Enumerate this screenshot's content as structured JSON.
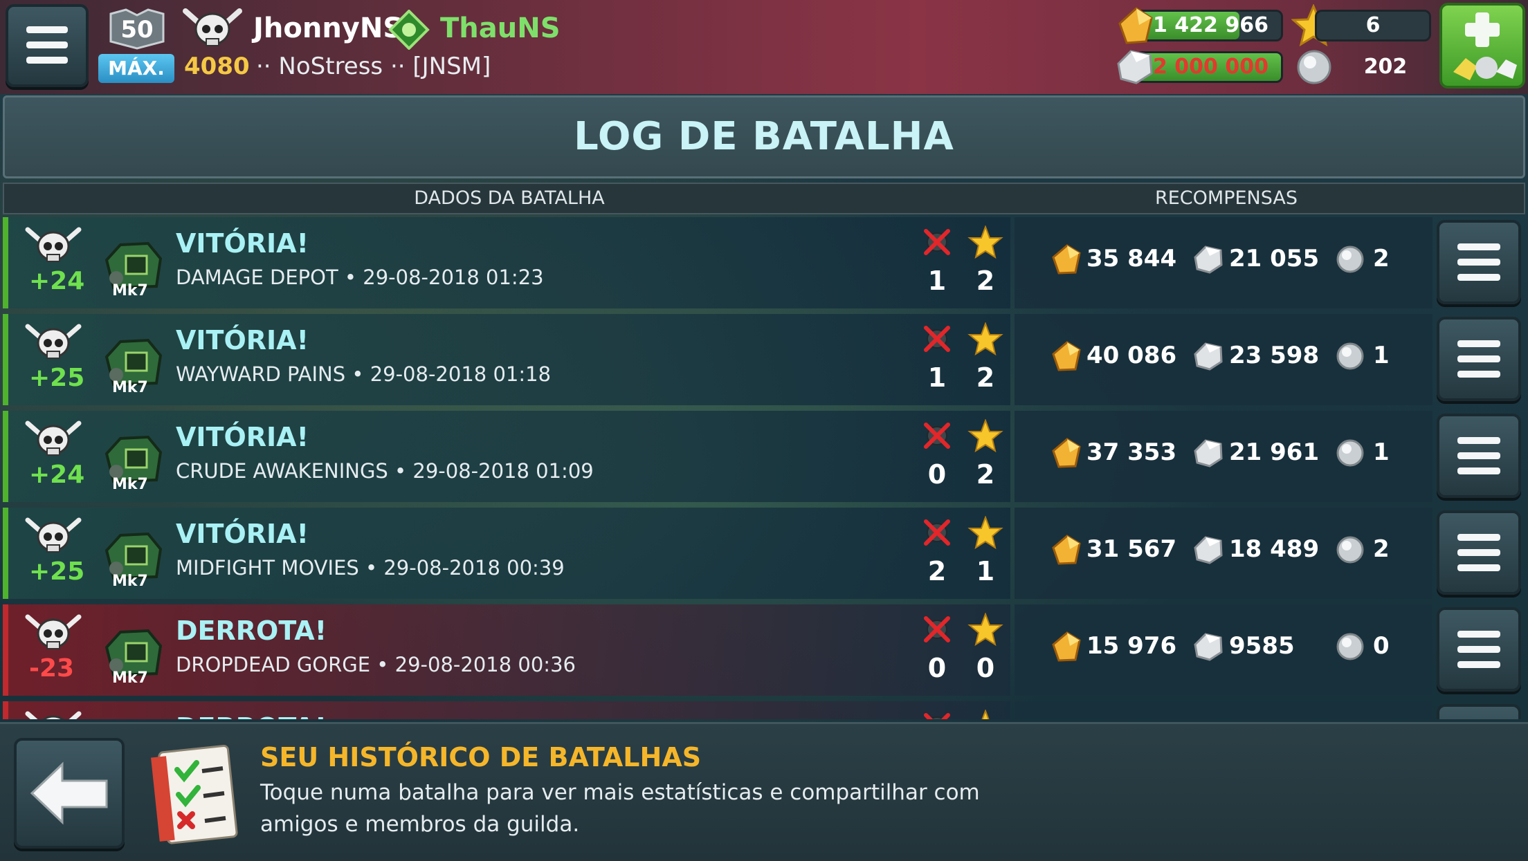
{
  "header": {
    "level": "50",
    "level_label": "MÁX.",
    "trophies": "4080",
    "player_name": "JhonnyNS",
    "guild_name": "ThauNS",
    "guild_tag": "·· NoStress ·· [JNSM]",
    "gold": "1 422 966",
    "silver": "2 000 000",
    "gold_fill_fraction": 0.71,
    "silver_fill_fraction": 1.0,
    "stars": "6",
    "tokens": "202"
  },
  "page": {
    "title": "LOG DE BATALHA",
    "col_battle": "DADOS DA BATALHA",
    "col_rewards": "RECOMPENSAS"
  },
  "battles": [
    {
      "result": "VITÓRIA!",
      "outcome": "win",
      "delta": "+24",
      "robot_mark": "Mk7",
      "map": "DAMAGE DEPOT",
      "datetime": "29-08-2018 01:23",
      "kills": "1",
      "stars": "2",
      "gold": "35 844",
      "silver": "21 055",
      "tokens": "2"
    },
    {
      "result": "VITÓRIA!",
      "outcome": "win",
      "delta": "+25",
      "robot_mark": "Mk7",
      "map": "WAYWARD PAINS",
      "datetime": "29-08-2018 01:18",
      "kills": "1",
      "stars": "2",
      "gold": "40 086",
      "silver": "23 598",
      "tokens": "1"
    },
    {
      "result": "VITÓRIA!",
      "outcome": "win",
      "delta": "+24",
      "robot_mark": "Mk7",
      "map": "CRUDE AWAKENINGS",
      "datetime": "29-08-2018 01:09",
      "kills": "0",
      "stars": "2",
      "gold": "37 353",
      "silver": "21 961",
      "tokens": "1"
    },
    {
      "result": "VITÓRIA!",
      "outcome": "win",
      "delta": "+25",
      "robot_mark": "Mk7",
      "map": "MIDFIGHT MOVIES",
      "datetime": "29-08-2018 00:39",
      "kills": "2",
      "stars": "1",
      "gold": "31 567",
      "silver": "18 489",
      "tokens": "2"
    },
    {
      "result": "DERROTA!",
      "outcome": "loss",
      "delta": "-23",
      "robot_mark": "Mk7",
      "map": "DROPDEAD GORGE",
      "datetime": "29-08-2018 00:36",
      "kills": "0",
      "stars": "0",
      "gold": "15 976",
      "silver": "9585",
      "tokens": "0"
    },
    {
      "result": "DERROTA!",
      "outcome": "loss",
      "delta": "",
      "robot_mark": "",
      "map": "",
      "datetime": "",
      "kills": "",
      "stars": "",
      "gold": "",
      "silver": "",
      "tokens": ""
    }
  ],
  "footer": {
    "title": "SEU HISTÓRICO DE BATALHAS",
    "text": "Toque numa batalha para ver mais estatísticas e compartilhar com amigos e membros da guilda."
  },
  "icons": {
    "menu": "hamburger-menu-icon",
    "back": "back-arrow-icon",
    "shop": "plus-shop-icon",
    "gold": "gold-icon",
    "silver": "silver-icon",
    "star": "star-icon",
    "token": "token-icon",
    "kill": "kill-icon",
    "log": "battle-log-icon"
  },
  "colors": {
    "win": "#4fb32e",
    "loss": "#c0292e",
    "title": "#c9f3f6",
    "gold_text": "#f5c845",
    "footer_title": "#f5b62a"
  }
}
